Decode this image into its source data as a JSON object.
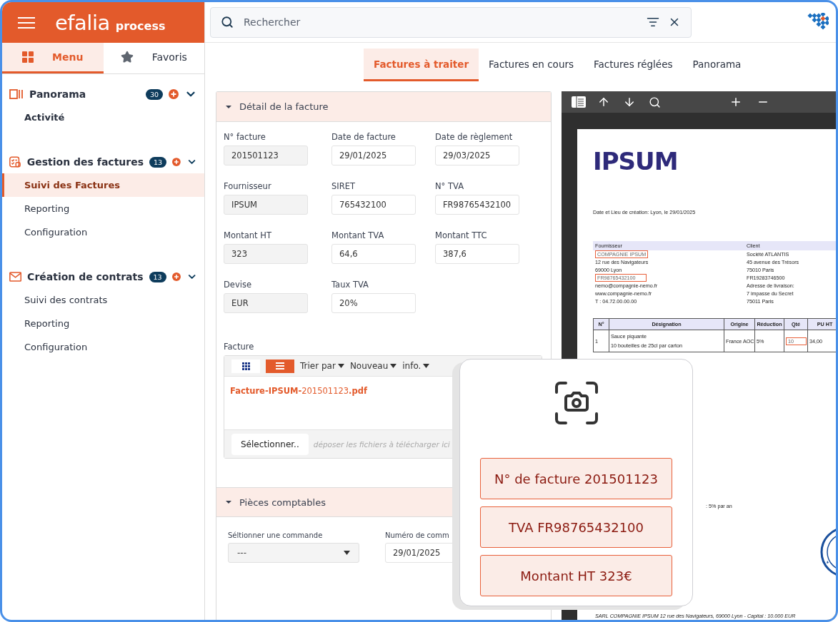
{
  "sidebar": {
    "brand": "efalia",
    "product": "process",
    "tabs": [
      {
        "label": "Menu",
        "kind": "menu",
        "selected": true
      },
      {
        "label": "Favoris",
        "kind": "favorites",
        "selected": false
      }
    ],
    "sections": [
      {
        "title": "Panorama",
        "kind": "panorama",
        "badge": "30",
        "expanded": true,
        "items": [
          {
            "label": "Activité",
            "bold": true,
            "selected": false
          }
        ]
      },
      {
        "title": "Gestion des factures",
        "kind": "invoices",
        "badge": "13",
        "expanded": true,
        "items": [
          {
            "label": "Suivi des Factures",
            "bold": false,
            "selected": true
          },
          {
            "label": "Reporting",
            "bold": false,
            "selected": false
          },
          {
            "label": "Configuration",
            "bold": false,
            "selected": false
          }
        ]
      },
      {
        "title": "Création de contrats",
        "kind": "contracts",
        "badge": "13",
        "expanded": true,
        "items": [
          {
            "label": "Suivi des contrats",
            "bold": false,
            "selected": false
          },
          {
            "label": "Reporting",
            "bold": false,
            "selected": false
          },
          {
            "label": "Configuration",
            "bold": false,
            "selected": false
          }
        ]
      }
    ]
  },
  "search": {
    "placeholder": "Rechercher"
  },
  "tabs": [
    {
      "label": "Factures à traiter",
      "selected": true
    },
    {
      "label": "Factures en cours",
      "selected": false
    },
    {
      "label": "Factures réglées",
      "selected": false
    },
    {
      "label": "Panorama",
      "selected": false
    }
  ],
  "invoice_panel": {
    "title": "Détail de la facture",
    "expanded": true,
    "fields": [
      {
        "label": "N° facture",
        "value": "201501123",
        "readonly": true
      },
      {
        "label": "Date de facture",
        "value": "29/01/2025",
        "readonly": false
      },
      {
        "label": "Date de règlement",
        "value": "29/03/2025",
        "readonly": false
      },
      {
        "label": "Fournisseur",
        "value": "IPSUM",
        "readonly": true
      },
      {
        "label": "SIRET",
        "value": "765432100",
        "readonly": false
      },
      {
        "label": "N° TVA",
        "value": "FR98765432100",
        "readonly": false
      },
      {
        "label": "Montant HT",
        "value": "323",
        "readonly": true
      },
      {
        "label": "Montant TVA",
        "value": "64,6",
        "readonly": false
      },
      {
        "label": "Montant TTC",
        "value": "387,6",
        "readonly": false
      },
      {
        "label": "Devise",
        "value": "EUR",
        "readonly": true
      },
      {
        "label": "Taux TVA",
        "value": "20%",
        "readonly": false
      }
    ],
    "attachment": {
      "label": "Facture",
      "views": [
        {
          "kind": "grid",
          "selected": false
        },
        {
          "kind": "list",
          "selected": true
        }
      ],
      "menus": [
        "Trier par",
        "Nouveau",
        "info."
      ],
      "files": [
        "**Facture-IPSUM-**201501123**.pdf**"
      ],
      "select_button": "Sélectionner..",
      "drop_hint": "déposer les fichiers à télécharger ici"
    }
  },
  "accounting_panel": {
    "title": "Pièces comptables",
    "expanded": true,
    "fields": [
      {
        "kind": "select",
        "label": "Séltionner une commande",
        "value": "---"
      },
      {
        "kind": "text",
        "label": "Numéro de comm",
        "value": "29/01/2025"
      }
    ]
  },
  "viewer": {
    "document": {
      "logo": "IPSUM",
      "date_line": "Date et Lieu de création: Lyon, le 29/01/2025",
      "party_headers": [
        "Fournisseur",
        "Client"
      ],
      "supplier_lines": [
        {
          "text": "COMPAGNIE IPSUM",
          "highlighted": true
        },
        {
          "text": "12 rue des Navigateurs",
          "highlighted": false
        },
        {
          "text": "69000 Lyon",
          "highlighted": false
        },
        {
          "text": "FR98765432100",
          "highlighted": true
        },
        {
          "text": "nemo@compagnie-nemo.fr",
          "highlighted": false
        },
        {
          "text": "www.compagnie-nemo.fr",
          "highlighted": false
        },
        {
          "text": "T : 04.72.00.00.00",
          "highlighted": false
        }
      ],
      "client_lines": [
        "Société ATLANTIS",
        "45 avenue des Trésors",
        "75010 Paris",
        "FR19283746500",
        "Adresse de livraison:",
        "7 impasse du Secret",
        "75011 Paris"
      ],
      "columns": [
        "N°",
        "Désignation",
        "Origine",
        "Réduction",
        "Qté",
        "PU HT"
      ],
      "rows": [
        {
          "no": "1",
          "designation": [
            "Sauce piquante",
            "10 bouteilles de 25cl par carton"
          ],
          "origin": "France AOC",
          "discount": "5%",
          "qty": "10",
          "qty_highlighted": true,
          "unit_price": "34,00"
        }
      ],
      "terms": ": 5% par an",
      "footer": "SARL COMPAGNIE IPSUM 12 rue des Navigateurs, 69000 Lyon - Capital : 10.000 EUR"
    }
  },
  "capture_popup": {
    "results": [
      "N° de facture 201501123",
      "TVA FR98765432100",
      "Montant HT 323€"
    ]
  }
}
